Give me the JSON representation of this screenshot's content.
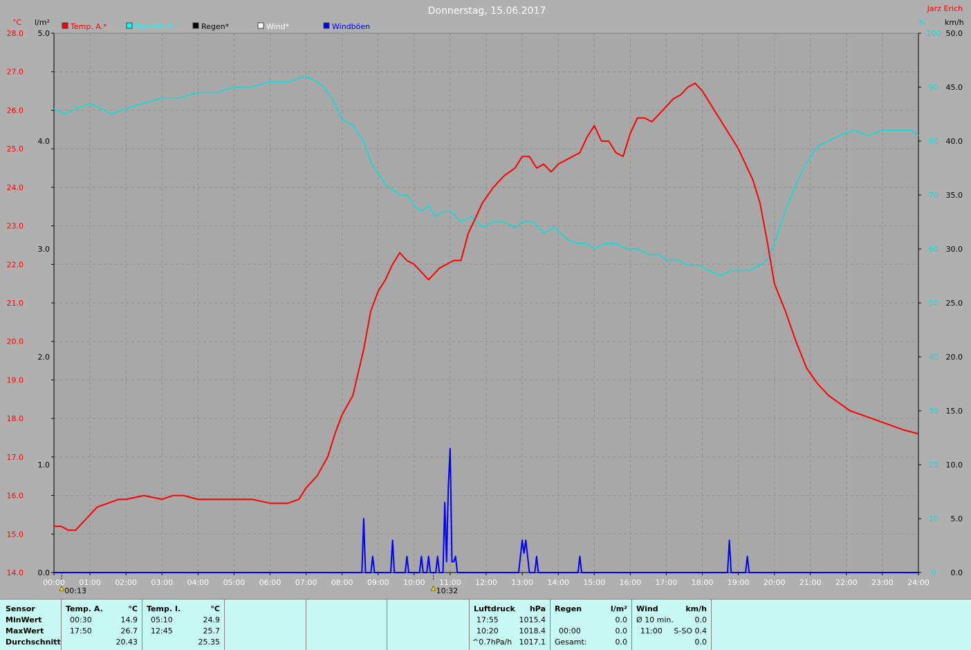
{
  "title": "Donnerstag, 15.06.2017",
  "author": "Jarz Erich",
  "axis_units": {
    "temp": "°C",
    "rain": "l/m²",
    "humidity": "%",
    "wind": "km/h"
  },
  "legend": [
    {
      "label": "Temp. A.*",
      "color": "#ff0000"
    },
    {
      "label": "Feuchte A.*",
      "color": "#00ffff"
    },
    {
      "label": "Regen*",
      "color": "#000000"
    },
    {
      "label": "Wind*",
      "color": "#ffffff"
    },
    {
      "label": "Windböen",
      "color": "#0000ff"
    }
  ],
  "markers": [
    {
      "label": "00:13",
      "hour": 0.217
    },
    {
      "label": "10:32",
      "hour": 10.533
    }
  ],
  "colors": {
    "temp": "#ff0000",
    "humidity": "#00e0e0",
    "gust": "#0000ff",
    "rain": "#000000",
    "wind": "#ffffff"
  },
  "chart_data": {
    "type": "line",
    "grid": true,
    "x_ticks": [
      "00:00",
      "01:00",
      "02:00",
      "03:00",
      "04:00",
      "05:00",
      "06:00",
      "07:00",
      "08:00",
      "09:00",
      "10:00",
      "11:00",
      "12:00",
      "13:00",
      "14:00",
      "15:00",
      "16:00",
      "17:00",
      "18:00",
      "19:00",
      "20:00",
      "21:00",
      "22:00",
      "23:00",
      "24:00"
    ],
    "xlim": [
      0,
      24
    ],
    "y_left_temp": {
      "ylim": [
        14.0,
        28.0
      ],
      "ticks": [
        "14.0",
        "15.0",
        "16.0",
        "17.0",
        "18.0",
        "19.0",
        "20.0",
        "21.0",
        "22.0",
        "23.0",
        "24.0",
        "25.0",
        "26.0",
        "27.0",
        "28.0"
      ]
    },
    "y_left_rain": {
      "ylim": [
        0,
        5
      ],
      "ticks": [
        "0.0",
        "1.0",
        "2.0",
        "3.0",
        "4.0",
        "5.0"
      ]
    },
    "y_right_humidity": {
      "ylim": [
        0,
        100
      ],
      "ticks": [
        "0",
        "10",
        "20",
        "30",
        "40",
        "50",
        "60",
        "70",
        "80",
        "90",
        "100"
      ]
    },
    "y_right_wind": {
      "ylim": [
        0,
        50
      ],
      "ticks": [
        "0.0",
        "5.0",
        "10.0",
        "15.0",
        "20.0",
        "25.0",
        "30.0",
        "35.0",
        "40.0",
        "45.0",
        "50.0"
      ]
    },
    "series": [
      {
        "name": "Temp. A.*",
        "axis": "temp",
        "x": [
          0,
          0.2,
          0.4,
          0.6,
          0.8,
          1.0,
          1.2,
          1.5,
          1.8,
          2.0,
          2.5,
          3.0,
          3.3,
          3.6,
          4.0,
          4.5,
          5.0,
          5.5,
          6.0,
          6.2,
          6.5,
          6.8,
          7.0,
          7.3,
          7.6,
          7.8,
          8.0,
          8.3,
          8.6,
          8.8,
          9.0,
          9.2,
          9.4,
          9.6,
          9.8,
          10.0,
          10.2,
          10.4,
          10.5,
          10.7,
          10.9,
          11.1,
          11.3,
          11.5,
          11.7,
          11.9,
          12.2,
          12.5,
          12.8,
          13.0,
          13.2,
          13.4,
          13.6,
          13.8,
          14.0,
          14.2,
          14.4,
          14.6,
          14.8,
          15.0,
          15.2,
          15.4,
          15.6,
          15.8,
          16.0,
          16.2,
          16.4,
          16.6,
          16.8,
          17.0,
          17.2,
          17.4,
          17.6,
          17.8,
          18.0,
          18.2,
          18.4,
          18.6,
          18.8,
          19.0,
          19.2,
          19.4,
          19.6,
          19.8,
          20.0,
          20.3,
          20.6,
          20.9,
          21.2,
          21.5,
          21.8,
          22.1,
          22.4,
          22.7,
          23.0,
          23.3,
          23.6,
          24.0
        ],
        "y": [
          15.2,
          15.2,
          15.1,
          15.1,
          15.3,
          15.5,
          15.7,
          15.8,
          15.9,
          15.9,
          16.0,
          15.9,
          16.0,
          16.0,
          15.9,
          15.9,
          15.9,
          15.9,
          15.8,
          15.8,
          15.8,
          15.9,
          16.2,
          16.5,
          17.0,
          17.6,
          18.1,
          18.6,
          19.8,
          20.8,
          21.3,
          21.6,
          22.0,
          22.3,
          22.1,
          22.0,
          21.8,
          21.6,
          21.7,
          21.9,
          22.0,
          22.1,
          22.1,
          22.8,
          23.2,
          23.6,
          24.0,
          24.3,
          24.5,
          24.8,
          24.8,
          24.5,
          24.6,
          24.4,
          24.6,
          24.7,
          24.8,
          24.9,
          25.3,
          25.6,
          25.2,
          25.2,
          24.9,
          24.8,
          25.4,
          25.8,
          25.8,
          25.7,
          25.9,
          26.1,
          26.3,
          26.4,
          26.6,
          26.7,
          26.5,
          26.2,
          25.9,
          25.6,
          25.3,
          25.0,
          24.6,
          24.2,
          23.6,
          22.6,
          21.5,
          20.8,
          20.0,
          19.3,
          18.9,
          18.6,
          18.4,
          18.2,
          18.1,
          18.0,
          17.9,
          17.8,
          17.7,
          17.6
        ]
      },
      {
        "name": "Feuchte A.*",
        "axis": "humidity",
        "x": [
          0,
          0.3,
          0.6,
          1.0,
          1.3,
          1.6,
          2.0,
          2.5,
          3.0,
          3.5,
          4.0,
          4.5,
          5.0,
          5.5,
          6.0,
          6.5,
          7.0,
          7.3,
          7.5,
          7.8,
          8.0,
          8.3,
          8.6,
          8.8,
          9.0,
          9.2,
          9.4,
          9.6,
          9.8,
          10.0,
          10.2,
          10.4,
          10.6,
          10.8,
          11.0,
          11.3,
          11.6,
          11.9,
          12.2,
          12.5,
          12.8,
          13.0,
          13.3,
          13.6,
          13.9,
          14.2,
          14.5,
          14.8,
          15.0,
          15.3,
          15.6,
          15.9,
          16.2,
          16.5,
          16.8,
          17.0,
          17.3,
          17.6,
          17.9,
          18.2,
          18.5,
          18.8,
          19.0,
          19.3,
          19.6,
          19.8,
          20.0,
          20.3,
          20.6,
          20.9,
          21.2,
          21.5,
          21.8,
          22.2,
          22.6,
          23.0,
          23.4,
          23.8,
          24.0
        ],
        "y": [
          86,
          85,
          86,
          87,
          86,
          85,
          86,
          87,
          88,
          88,
          89,
          89,
          90,
          90,
          91,
          91,
          92,
          91,
          90,
          87,
          84,
          83,
          80,
          76,
          74,
          72,
          71,
          70,
          70,
          68,
          67,
          68,
          66,
          67,
          67,
          65,
          66,
          64,
          65,
          65,
          64,
          65,
          65,
          63,
          64,
          62,
          61,
          61,
          60,
          61,
          61,
          60,
          60,
          59,
          59,
          58,
          58,
          57,
          57,
          56,
          55,
          56,
          56,
          56,
          57,
          58,
          61,
          67,
          72,
          76,
          79,
          80,
          81,
          82,
          81,
          82,
          82,
          82,
          81
        ]
      },
      {
        "name": "Windböen",
        "axis": "wind",
        "x": [
          0,
          8.55,
          8.6,
          8.65,
          8.8,
          8.85,
          8.9,
          9.35,
          9.4,
          9.45,
          9.75,
          9.8,
          9.85,
          10.15,
          10.2,
          10.25,
          10.35,
          10.4,
          10.45,
          10.6,
          10.65,
          10.7,
          10.8,
          10.85,
          10.9,
          10.95,
          11.0,
          11.05,
          11.1,
          11.15,
          11.2,
          11.25,
          11.3,
          11.35,
          11.4,
          12.9,
          13.0,
          13.05,
          13.1,
          13.15,
          13.2,
          13.35,
          13.4,
          13.45,
          14.55,
          14.6,
          14.65,
          18.7,
          18.75,
          18.8,
          19.2,
          19.25,
          19.3,
          24.0
        ],
        "y": [
          0,
          0,
          5,
          0,
          0,
          1.5,
          0,
          0,
          3,
          0,
          0,
          1.5,
          0,
          0,
          1.5,
          0,
          0,
          1.5,
          0,
          0,
          1.5,
          0,
          0,
          6.5,
          1,
          8,
          11.5,
          1,
          1,
          1.5,
          0,
          0,
          0,
          0,
          0,
          0,
          3,
          1.8,
          3,
          1.5,
          0,
          0,
          1.5,
          0,
          0,
          1.5,
          0,
          0,
          3,
          0,
          0,
          1.5,
          0,
          0
        ]
      }
    ]
  },
  "stats": {
    "sensor": {
      "header": "Sensor",
      "rows": [
        "MinWert",
        "MaxWert",
        "Durchschnitt"
      ]
    },
    "temp_a": {
      "header": "Temp. A.",
      "unit": "°C",
      "min_time": "00:30",
      "min": "14.9",
      "max_time": "17:50",
      "max": "26.7",
      "avg": "20.43"
    },
    "temp_i": {
      "header": "Temp. I.",
      "unit": "°C",
      "min_time": "05:10",
      "min": "24.9",
      "max_time": "12:45",
      "max": "25.7",
      "avg": "25.35"
    },
    "pressure": {
      "header": "Luftdruck",
      "unit": "hPa",
      "r1_label": "17:55",
      "r1": "1015.4",
      "r2_label": "10:20",
      "r2": "1018.4",
      "r3_label": "^0.7hPa/h",
      "r3": "1017.1"
    },
    "rain": {
      "header": "Regen",
      "unit": "l/m²",
      "r2_label": "00:00",
      "r2": "0.0",
      "r1": "0.0",
      "r3_label": "Gesamt:",
      "r3": "0.0"
    },
    "wind": {
      "header": "Wind",
      "unit": "km/h",
      "r1_label": "Ø 10 min.",
      "r1": "0.0",
      "r2_label": "11:00",
      "r2": "S-SO 0.4",
      "r3": "0.0"
    }
  }
}
